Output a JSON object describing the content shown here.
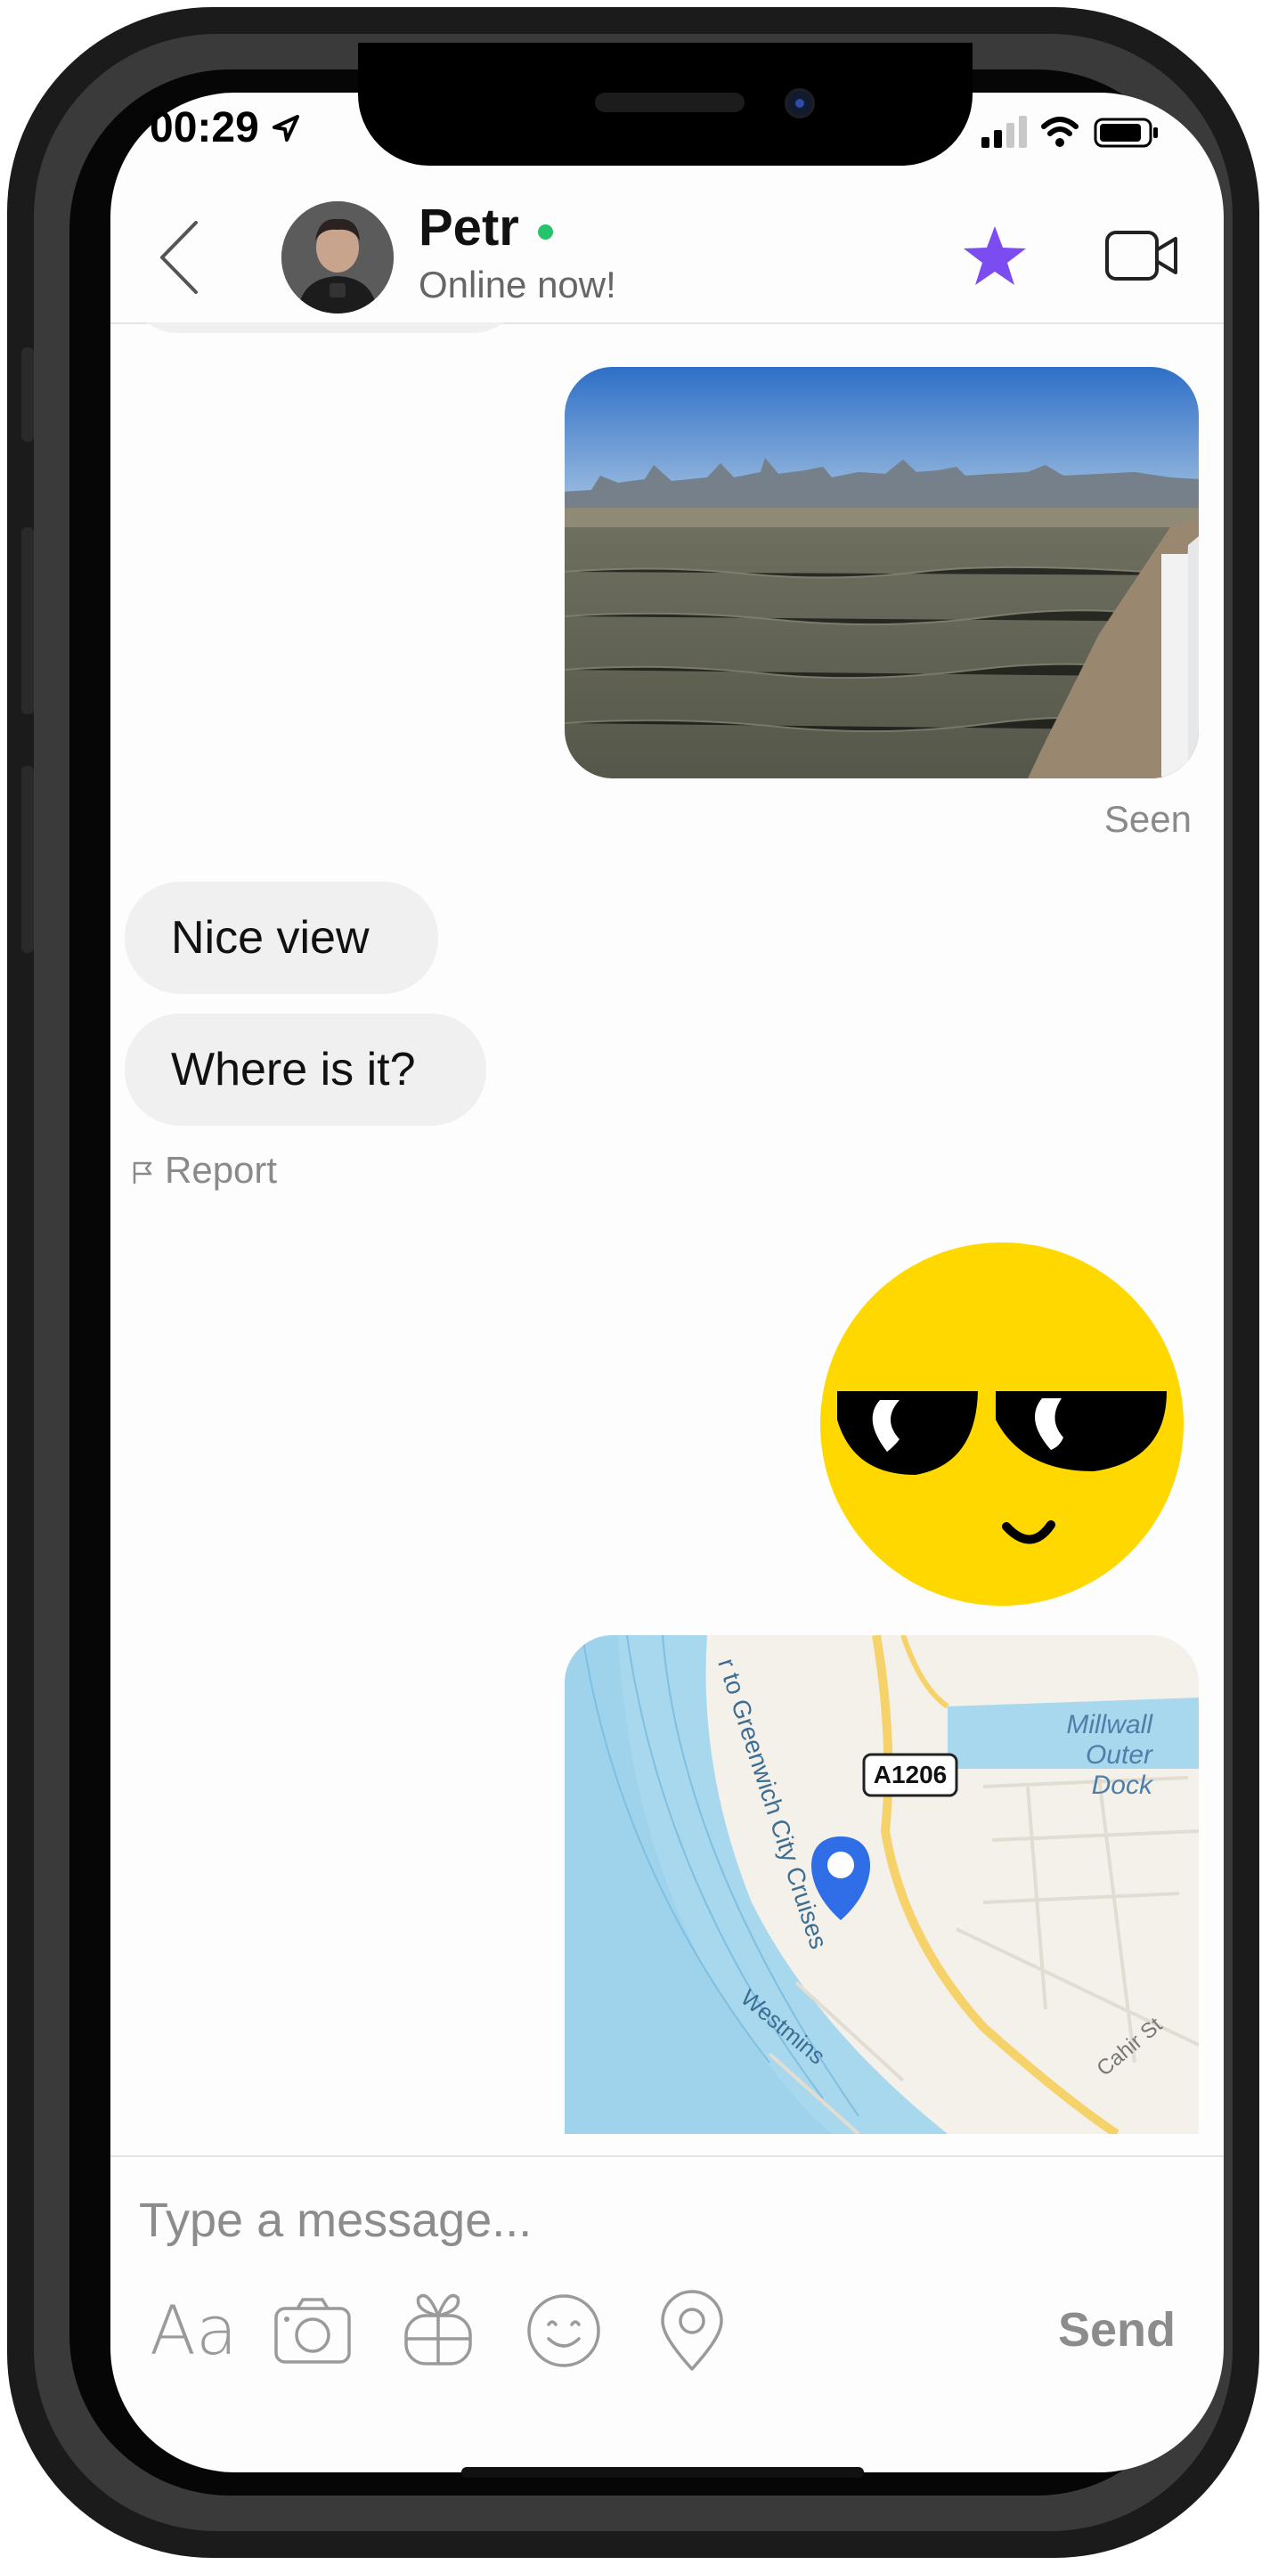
{
  "status_bar": {
    "time": "00:29"
  },
  "header": {
    "contact_name": "Petr",
    "status_text": "Online now!",
    "accent_color": "#7b4df0",
    "online_color": "#27c26c",
    "icons": [
      "back-chevron-icon",
      "star-icon",
      "video-call-icon"
    ]
  },
  "messages": {
    "photo": {
      "description_icon": "river-city-photo"
    },
    "seen_label": "Seen",
    "received": [
      {
        "text": "Nice view"
      },
      {
        "text": "Where is it?"
      }
    ],
    "report_label": "Report",
    "sticker": {
      "icon": "sunglasses-smiley-icon"
    },
    "map": {
      "labels": {
        "road_badge": "A1206",
        "dock": [
          "Millwall",
          "Outer",
          "Dock"
        ],
        "cruise": "r to Greenwich City Cruises",
        "street": "Cahir St",
        "westminster": "Westmins"
      }
    }
  },
  "composer": {
    "placeholder": "Type a message...",
    "font_tool_label": "Aa",
    "send_label": "Send",
    "tools": [
      "font-icon",
      "camera-icon",
      "gift-icon",
      "emoji-icon",
      "location-pin-icon"
    ]
  }
}
